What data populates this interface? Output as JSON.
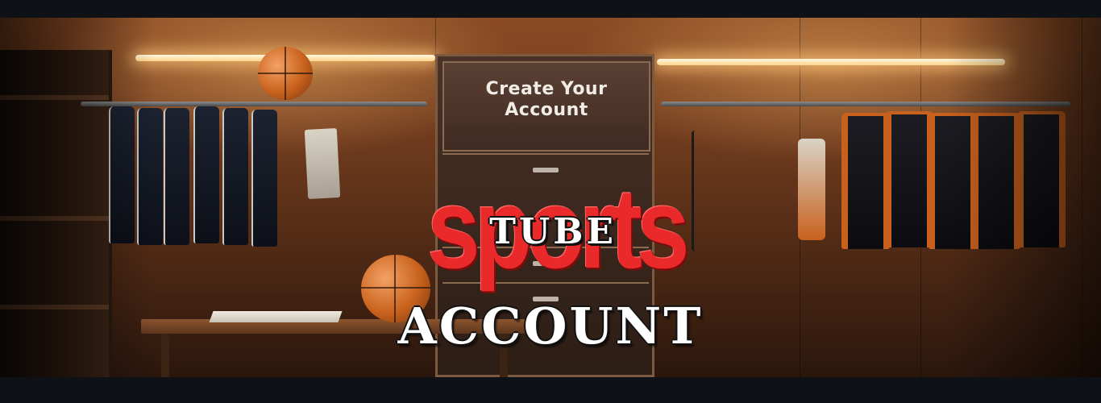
{
  "banner": {
    "sign_text": "Create Your Account",
    "logo_word_1": "sports",
    "logo_word_2": "TUBE",
    "heading": "ACCOUNT"
  },
  "colors": {
    "logo_red": "#ea2a2a",
    "background": "#0e1116",
    "wood": "#6e3a1d"
  }
}
